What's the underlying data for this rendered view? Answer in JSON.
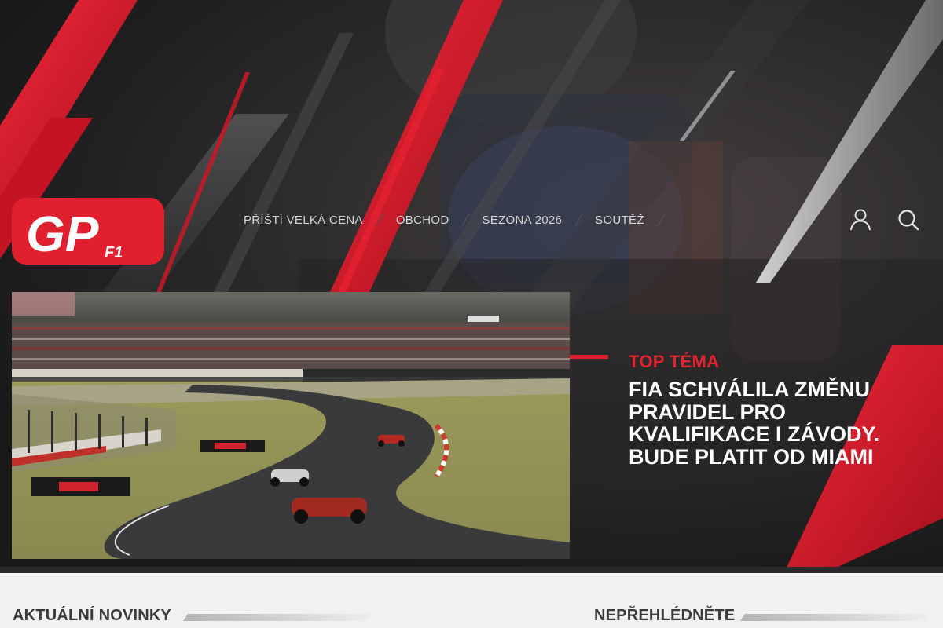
{
  "brand": {
    "logo_text": "GP",
    "logo_sub": "F1",
    "accent_color": "#e0202f"
  },
  "nav": {
    "items": [
      {
        "label": "PŘÍŠTÍ VELKÁ CENA"
      },
      {
        "label": "OBCHOD"
      },
      {
        "label": "SEZONA 2026"
      },
      {
        "label": "SOUTĚŽ"
      }
    ]
  },
  "header_icons": [
    "user-icon",
    "search-icon"
  ],
  "feature": {
    "label": "TOP TÉMA",
    "title": "FIA SCHVÁLILA ZMĚNU PRAVIDEL PRO KVALIFIKACE I ZÁVODY. BUDE PLATIT OD MIAMI"
  },
  "sections": {
    "latest": "AKTUÁLNÍ NOVINKY",
    "dont_miss": "NEPŘEHLÉDNĚTE"
  }
}
